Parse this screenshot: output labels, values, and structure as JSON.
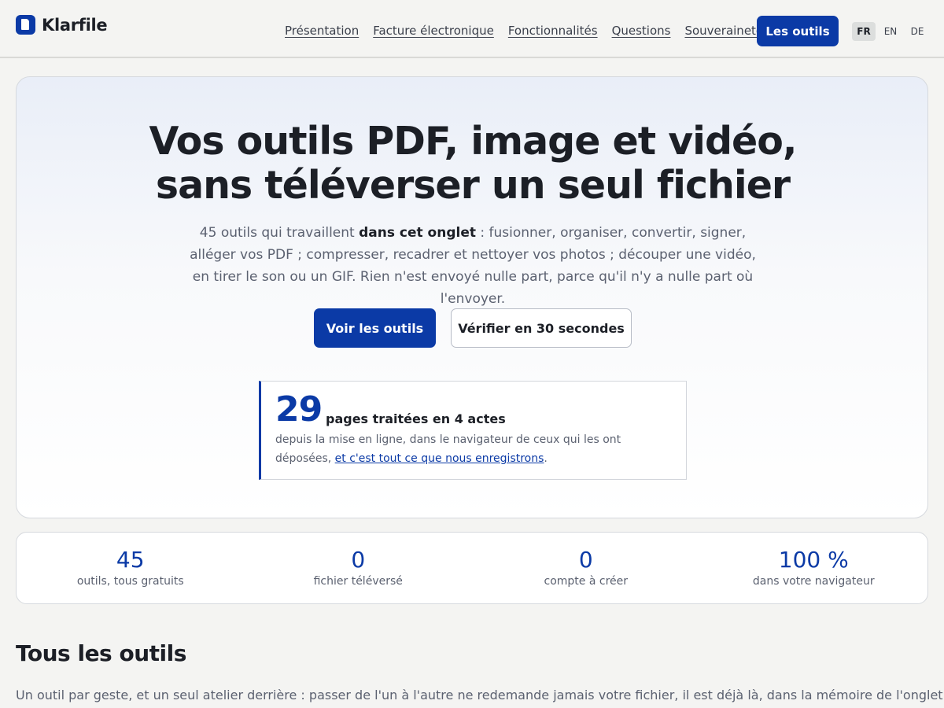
{
  "brand": {
    "name": "Klarfile"
  },
  "nav": {
    "items": [
      "Présentation",
      "Facture électronique",
      "Fonctionnalités",
      "Questions",
      "Souveraineté"
    ],
    "cta_label": "Les outils",
    "languages": [
      "FR",
      "EN",
      "DE"
    ],
    "active_language": "FR"
  },
  "hero": {
    "title_line1": "Vos outils PDF, image et vidéo,",
    "title_line2": "sans téléverser un seul fichier",
    "subtitle_before_bold": "45 outils qui travaillent ",
    "subtitle_bold": "dans cet onglet",
    "subtitle_after_bold": " : fusionner, organiser, convertir, signer, alléger vos PDF ; compresser, recadrer et nettoyer vos photos ; découper une vidéo, en tirer le son ou un GIF. Rien n'est envoyé nulle part, parce qu'il n'y a nulle part où l'envoyer.",
    "primary_button": "Voir les outils",
    "secondary_button": "Vérifier en 30 secondes",
    "counter": {
      "number": "29",
      "label": "pages traitées en 4 actes",
      "text_before_link": "depuis la mise en ligne, dans le navigateur de ceux qui les ont déposées, ",
      "link": "et c'est tout ce que nous enregistrons",
      "text_after_link": "."
    }
  },
  "stats": [
    {
      "value": "45",
      "label": "outils, tous gratuits"
    },
    {
      "value": "0",
      "label": "fichier téléversé"
    },
    {
      "value": "0",
      "label": "compte à créer"
    },
    {
      "value": "100 %",
      "label": "dans votre navigateur"
    }
  ],
  "section": {
    "title": "Tous les outils",
    "subtitle": "Un outil par geste, et un seul atelier derrière : passer de l'un à l'autre ne redemande jamais votre fichier, il est déjà là, dans la mémoire de l'onglet."
  },
  "colors": {
    "accent": "#0b3aa6",
    "text": "#1c1f26",
    "muted": "#5b6170",
    "background": "#f4f4f2"
  }
}
